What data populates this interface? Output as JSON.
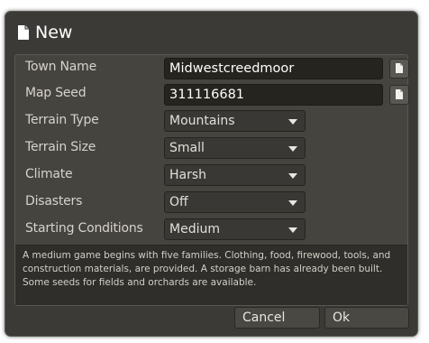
{
  "dialog": {
    "title": "New",
    "title_icon": "document-icon"
  },
  "form": {
    "town_name": {
      "label": "Town Name",
      "value": "Midwestcreedmoor"
    },
    "map_seed": {
      "label": "Map Seed",
      "value": "311116681"
    },
    "terrain_type": {
      "label": "Terrain Type",
      "value": "Mountains"
    },
    "terrain_size": {
      "label": "Terrain Size",
      "value": "Small"
    },
    "climate": {
      "label": "Climate",
      "value": "Harsh"
    },
    "disasters": {
      "label": "Disasters",
      "value": "Off"
    },
    "starting_conditions": {
      "label": "Starting Conditions",
      "value": "Medium"
    }
  },
  "description": "A medium game begins with five families. Clothing, food, firewood, tools, and construction materials, are provided. A storage barn has already been built. Some seeds for fields and orchards are available.",
  "buttons": {
    "cancel": "Cancel",
    "ok": "Ok"
  },
  "colors": {
    "dialog_bg": "#3b3a37",
    "panel_bg": "#46443f",
    "field_bg": "#25241f",
    "text": "#d6d3cc"
  }
}
